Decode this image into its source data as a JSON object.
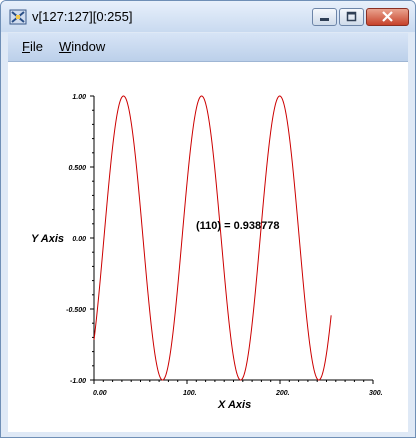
{
  "window": {
    "title": "v[127:127][0:255]"
  },
  "menu": {
    "file": "File",
    "window": "Window"
  },
  "chart_data": {
    "type": "line",
    "xlabel": "X Axis",
    "ylabel": "Y Axis",
    "xlim": [
      0,
      300
    ],
    "ylim": [
      -1,
      1
    ],
    "x_ticks": [
      "0.00",
      "100.",
      "200.",
      "300."
    ],
    "y_ticks": [
      "1.00",
      "0.500",
      "0.00",
      "-0.500",
      "-1.00"
    ],
    "annotation": "(110) = 0.938778",
    "grid": false,
    "series": [
      {
        "color": "#cc0000",
        "x_start": 0,
        "x_end": 255,
        "function": "sin",
        "period": 84.0,
        "phase": -0.8
      }
    ],
    "line_color": "#cc0000"
  }
}
